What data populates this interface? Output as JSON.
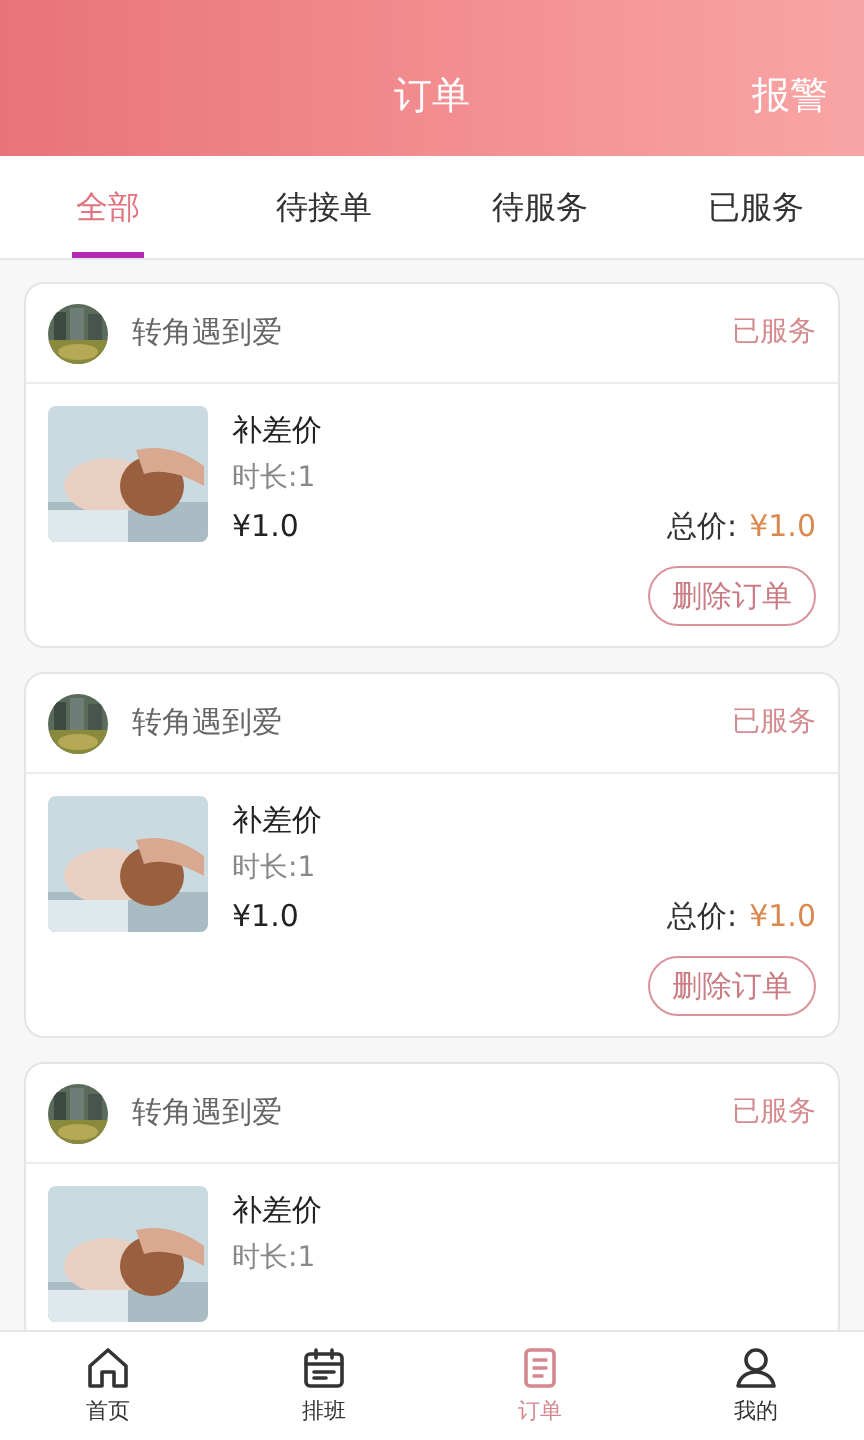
{
  "header": {
    "title": "订单",
    "action": "报警"
  },
  "tabs": [
    {
      "label": "全部",
      "selected": true
    },
    {
      "label": "待接单",
      "selected": false
    },
    {
      "label": "待服务",
      "selected": false
    },
    {
      "label": "已服务",
      "selected": false
    }
  ],
  "orders": [
    {
      "user": "转角遇到爱",
      "status": "已服务",
      "item": "补差价",
      "duration": "时长:1",
      "price": "¥1.0",
      "total_label": "总价:",
      "total": "¥1.0",
      "delete_button": "删除订单"
    },
    {
      "user": "转角遇到爱",
      "status": "已服务",
      "item": "补差价",
      "duration": "时长:1",
      "price": "¥1.0",
      "total_label": "总价:",
      "total": "¥1.0",
      "delete_button": "删除订单"
    },
    {
      "user": "转角遇到爱",
      "status": "已服务",
      "item": "补差价",
      "duration": "时长:1"
    }
  ],
  "nav": [
    {
      "label": "首页",
      "kind": "home",
      "selected": false
    },
    {
      "label": "排班",
      "kind": "schedule",
      "selected": false
    },
    {
      "label": "订单",
      "kind": "orders",
      "selected": true
    },
    {
      "label": "我的",
      "kind": "profile",
      "selected": false
    }
  ]
}
